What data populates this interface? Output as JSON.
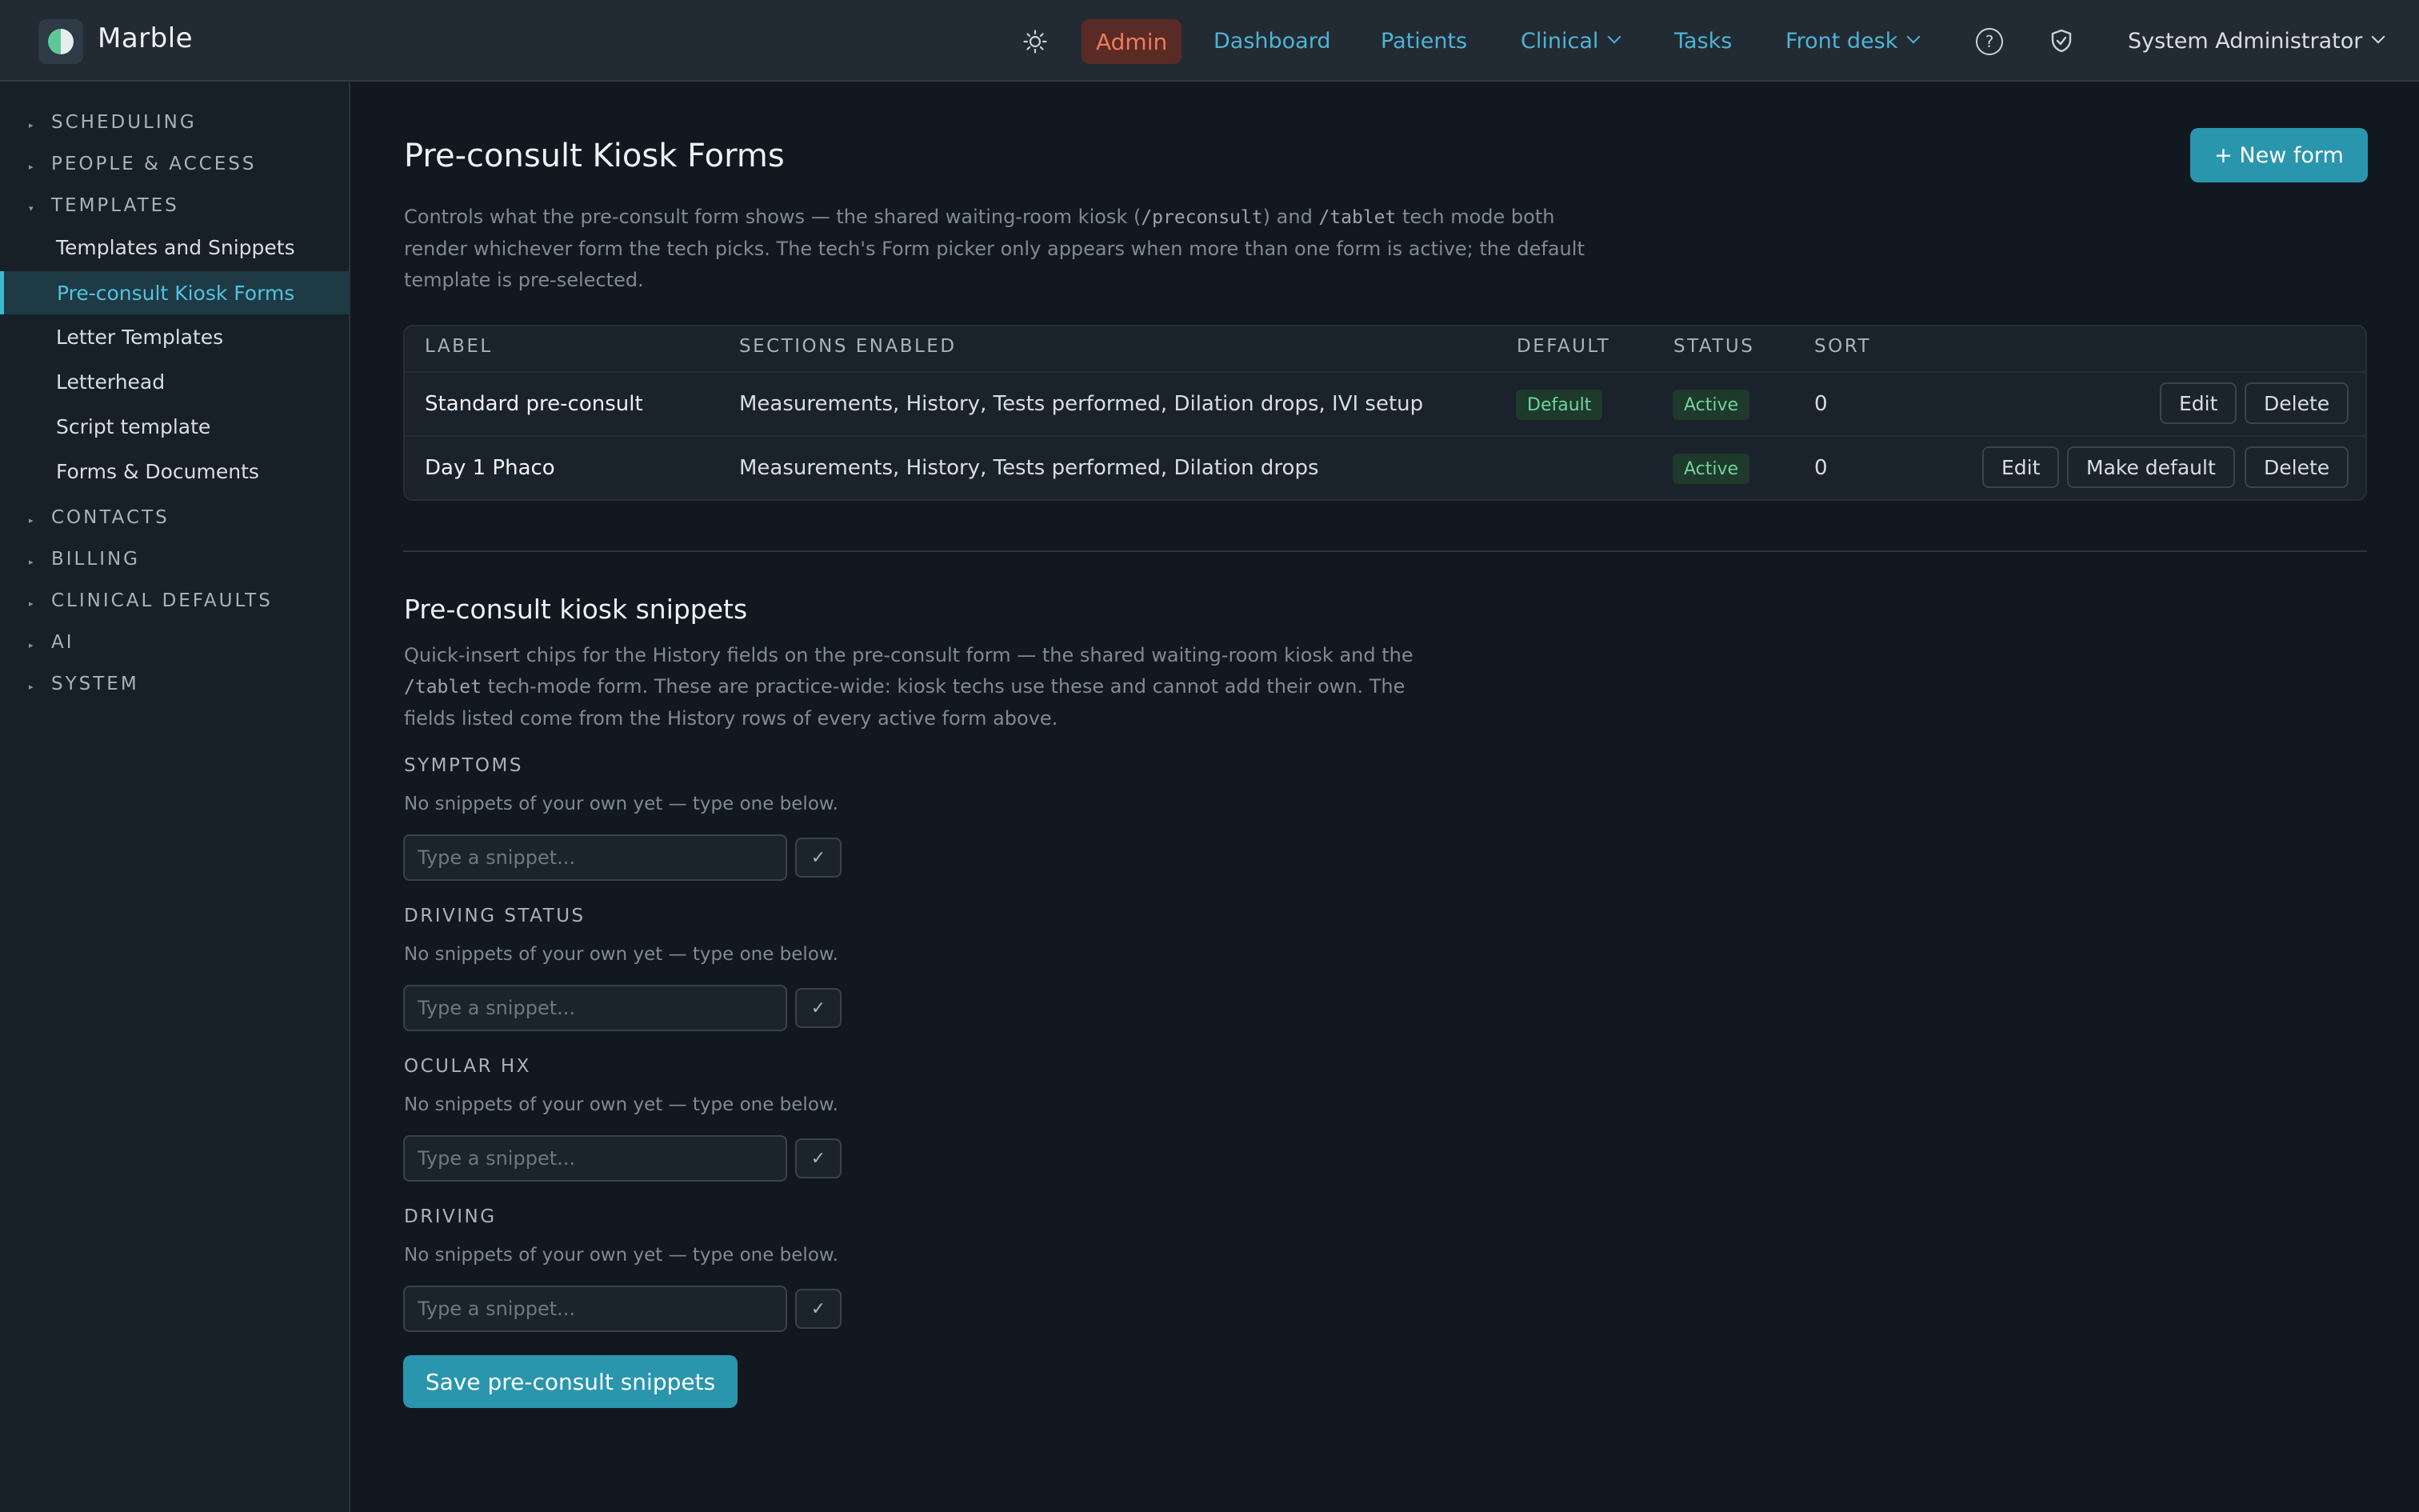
{
  "app": {
    "name": "Marble"
  },
  "topnav": {
    "admin": "Admin",
    "dashboard": "Dashboard",
    "patients": "Patients",
    "clinical": "Clinical",
    "tasks": "Tasks",
    "front_desk": "Front desk",
    "help_icon": "?",
    "user": "System Administrator",
    "icons": [
      "sun-icon",
      "help-icon",
      "shield-icon",
      "chevron-down-icon"
    ]
  },
  "sidebar": {
    "sections": {
      "scheduling": "SCHEDULING",
      "people": "PEOPLE & ACCESS",
      "templates": "TEMPLATES",
      "contacts": "CONTACTS",
      "billing": "BILLING",
      "clinical_defaults": "CLINICAL DEFAULTS",
      "ai": "AI",
      "system": "SYSTEM"
    },
    "template_items": {
      "snippets": "Templates and Snippets",
      "kiosk": "Pre-consult Kiosk Forms",
      "letters": "Letter Templates",
      "letterhead": "Letterhead",
      "script": "Script template",
      "forms": "Forms & Documents"
    },
    "triangle_right": "▸",
    "triangle_down": "▾"
  },
  "page": {
    "title": "Pre-consult Kiosk Forms",
    "new_button": "+ New form",
    "desc1_a": "Controls what the pre-consult form shows — the shared waiting-room kiosk (",
    "desc1_code1": "/preconsult",
    "desc1_b": ") and ",
    "desc1_code2": "/tablet",
    "desc1_c": " tech mode both",
    "desc2": "render whichever form the tech picks. The tech's Form picker only appears when more than one form is active; the default",
    "desc3": "template is pre-selected."
  },
  "table": {
    "headers": {
      "label": "LABEL",
      "sections": "SECTIONS ENABLED",
      "default": "DEFAULT",
      "status": "STATUS",
      "sort": "SORT"
    },
    "rows": [
      {
        "label": "Standard pre-consult",
        "sections": "Measurements, History, Tests performed, Dilation drops, IVI setup",
        "default": "Default",
        "status": "Active",
        "sort": "0",
        "edit": "Edit",
        "delete": "Delete"
      },
      {
        "label": "Day 1 Phaco",
        "sections": "Measurements, History, Tests performed, Dilation drops",
        "status": "Active",
        "sort": "0",
        "edit": "Edit",
        "make_default": "Make default",
        "delete": "Delete"
      }
    ]
  },
  "snippets": {
    "title": "Pre-consult kiosk snippets",
    "desc1": "Quick-insert chips for the History fields on the pre-consult form — the shared waiting-room kiosk and the",
    "desc2_code": "/tablet",
    "desc2_b": " tech-mode form. These are practice-wide: kiosk techs use these and cannot add their own. The",
    "desc3": "fields listed come from the History rows of every active form above.",
    "empty_note": "No snippets of your own yet — type one below.",
    "placeholder": "Type a snippet...",
    "check": "✓",
    "fields": [
      "SYMPTOMS",
      "DRIVING STATUS",
      "OCULAR HX",
      "DRIVING"
    ],
    "save_button": "Save pre-consult snippets"
  }
}
